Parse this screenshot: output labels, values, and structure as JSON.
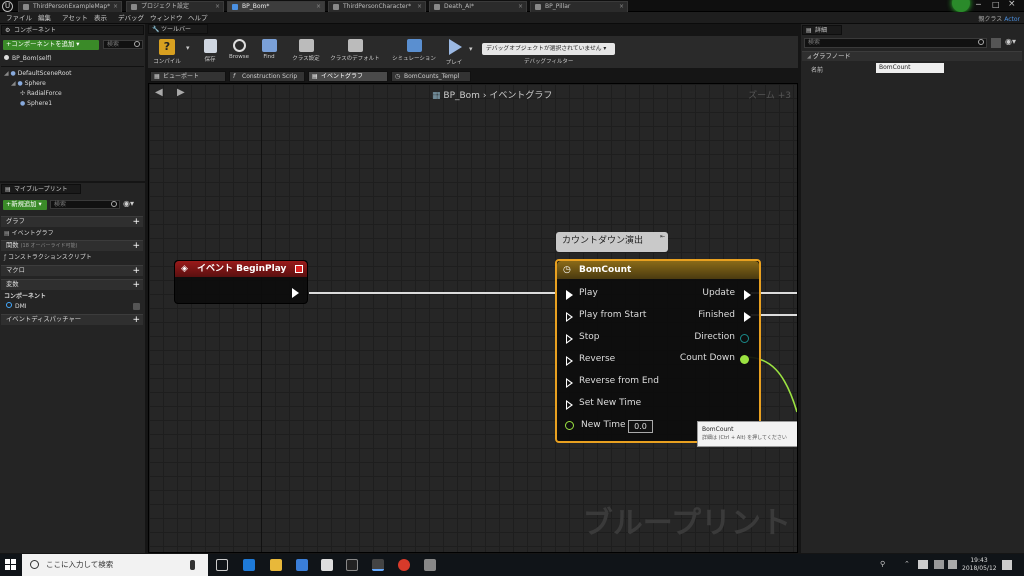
{
  "tabs": [
    {
      "label": "ThirdPersonExampleMap*",
      "active": false
    },
    {
      "label": "プロジェクト設定",
      "active": false
    },
    {
      "label": "BP_Bom*",
      "active": true
    },
    {
      "label": "ThirdPersonCharacter*",
      "active": false
    },
    {
      "label": "Death_AI*",
      "active": false
    },
    {
      "label": "BP_Pillar",
      "active": false
    }
  ],
  "logo": "U",
  "menu": [
    "ファイル",
    "編集",
    "アセット",
    "表示",
    "デバッグ",
    "ウィンドウ",
    "ヘルプ"
  ],
  "class_info": {
    "prefix": "親クラス",
    "value": "Actor"
  },
  "components": {
    "header": "コンポーネント",
    "add_button": "+コンポーネントを追加 ▾",
    "search_placeholder": "検索",
    "self_item": "BP_Bom(self)",
    "tree": [
      "DefaultSceneRoot",
      "Sphere",
      "RadialForce",
      "Sphere1"
    ]
  },
  "my_blueprint": {
    "header": "マイブループリント",
    "add_button": "+新規追加 ▾",
    "search_placeholder": "検索",
    "sections": {
      "graph": "グラフ",
      "event_graph": "イベントグラフ",
      "functions": "関数",
      "functions_note": "(18 オーバーライド可能)",
      "construction": "コンストラクションスクリプト",
      "macros": "マクロ",
      "variables": "変数",
      "components": "コンポーネント",
      "dmi": "DMI",
      "dispatchers": "イベントディスパッチャー"
    }
  },
  "toolbar": {
    "header": "ツールバー",
    "compile": "コンパイル",
    "save": "保存",
    "browse": "Browse",
    "find": "Find",
    "class_settings": "クラス設定",
    "class_defaults": "クラスのデフォルト",
    "simulation": "シミュレーション",
    "play": "プレイ",
    "debug_dropdown": "デバッグオブジェクトが選択されていません ▾",
    "debug_filter": "デバッグフィルター"
  },
  "doc_tabs": [
    "ビューポート",
    "Construction Scrip",
    "イベントグラフ",
    "BomCounts_Templ"
  ],
  "graph": {
    "breadcrumb_root": "BP_Bom",
    "breadcrumb_sep": "›",
    "breadcrumb_leaf": "イベントグラフ",
    "zoom": "ズーム +3",
    "watermark": "ブループリント",
    "comment": "カウントダウン演出",
    "begin_play_node": "イベント BeginPlay",
    "timeline_node": {
      "title": "BomCount",
      "inputs": [
        "Play",
        "Play from Start",
        "Stop",
        "Reverse",
        "Reverse from End",
        "Set New Time",
        "New Time"
      ],
      "outputs": [
        "Update",
        "Finished",
        "Direction",
        "Count Down"
      ],
      "new_time_value": "0.0"
    },
    "tooltip_title": "BomCount",
    "tooltip_text": "詳細は (Ctrl + Alt) を押してください"
  },
  "details": {
    "header": "詳細",
    "search_placeholder": "検索",
    "section": "グラフノード",
    "name_label": "名前",
    "name_value": "BomCount"
  },
  "taskbar": {
    "search_placeholder": "ここに入力して検索",
    "time": "19:43",
    "date": "2018/05/12"
  }
}
